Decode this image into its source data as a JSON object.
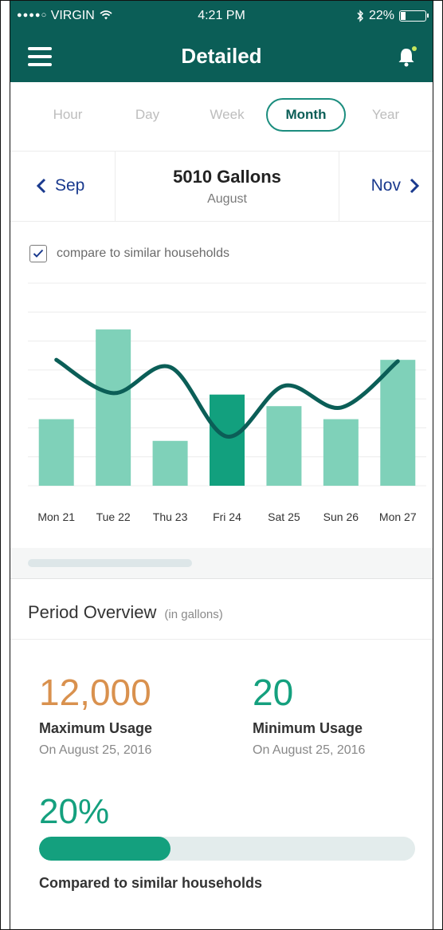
{
  "status_bar": {
    "signal_dots": "●●●●○",
    "carrier": "VIRGIN",
    "time": "4:21 PM",
    "battery": "22%",
    "battery_level": 0.22
  },
  "navbar": {
    "title": "Detailed",
    "menu_icon": "hamburger-menu-icon",
    "notification_icon": "bell-icon",
    "notification_dot_color": "#c6e65c"
  },
  "tabs": [
    {
      "label": "Hour",
      "active": false
    },
    {
      "label": "Day",
      "active": false
    },
    {
      "label": "Week",
      "active": false
    },
    {
      "label": "Month",
      "active": true
    },
    {
      "label": "Year",
      "active": false
    }
  ],
  "period": {
    "prev_label": "Sep",
    "next_label": "Nov",
    "amount": "5010 Gallons",
    "month": "August"
  },
  "compare": {
    "label": "compare to similar households",
    "checked": true
  },
  "colors": {
    "header": "#0b5e57",
    "bar": "#7fd1b9",
    "bar_highlight": "#12a07e",
    "line": "#0b5e57",
    "max_value": "#d9914e",
    "min_value": "#14a07e",
    "link": "#1a3a8e"
  },
  "chart_data": {
    "type": "bar",
    "categories": [
      "Mon 21",
      "Tue 22",
      "Thu 23",
      "Fri 24",
      "Sat 25",
      "Sun 26",
      "Mon 27"
    ],
    "series": [
      {
        "values": [
          46,
          108,
          31,
          63,
          55,
          46,
          87
        ],
        "highlight_index": 3
      },
      {
        "type": "line",
        "values": [
          87,
          64,
          82,
          34,
          69,
          54,
          86
        ]
      }
    ],
    "ylim": [
      0,
      140
    ],
    "grid": true
  },
  "overview": {
    "title": "Period Overview",
    "unit_note": "(in gallons)",
    "max": {
      "value": "12,000",
      "label": "Maximum Usage",
      "date": "On August 25, 2016"
    },
    "min": {
      "value": "20",
      "label": "Minimum Usage",
      "date": "On August 25, 2016"
    },
    "comparison": {
      "percent": "20%",
      "fraction": 0.35,
      "label": "Compared to similar households"
    }
  }
}
